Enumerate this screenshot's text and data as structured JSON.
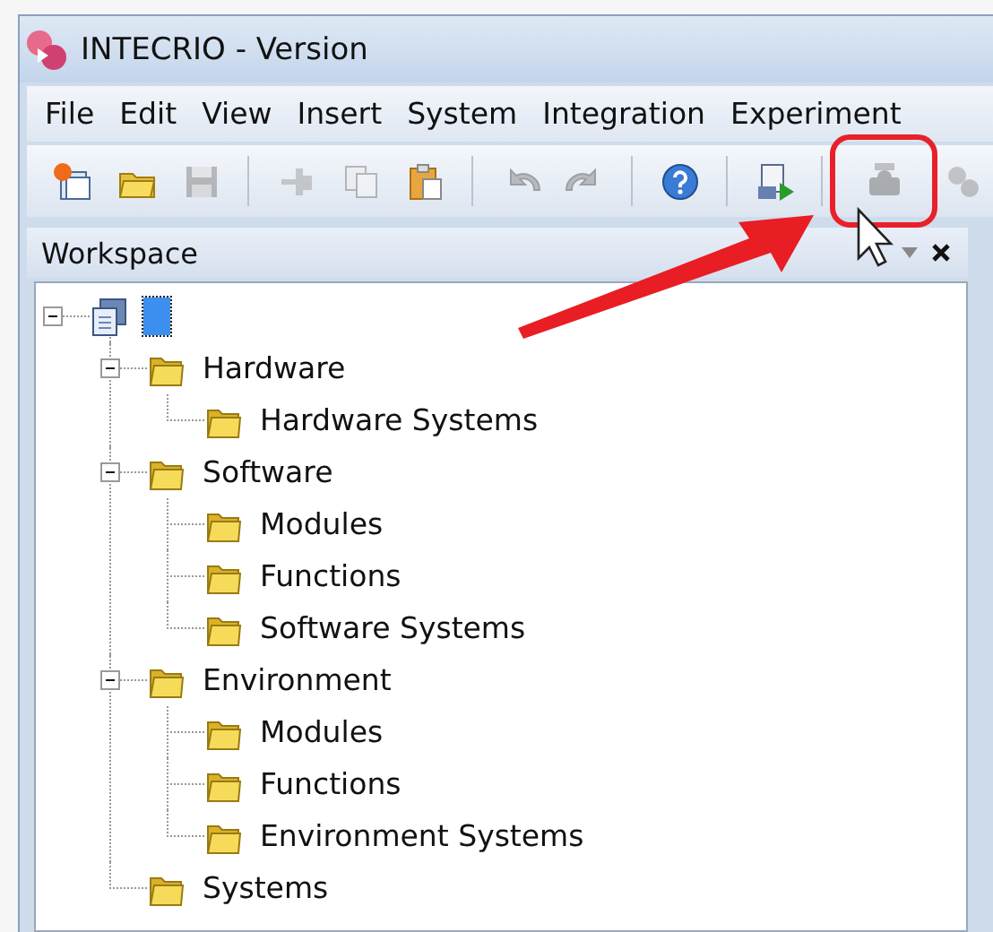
{
  "window": {
    "title": "INTECRIO - Version"
  },
  "menu": [
    "File",
    "Edit",
    "View",
    "Insert",
    "System",
    "Integration",
    "Experiment"
  ],
  "toolbar": [
    {
      "kind": "button",
      "disabled": false,
      "highlighted": false
    },
    {
      "kind": "button",
      "disabled": false,
      "highlighted": false
    },
    {
      "kind": "button",
      "disabled": true,
      "highlighted": false
    },
    {
      "kind": "separator"
    },
    {
      "kind": "button",
      "disabled": true,
      "highlighted": false
    },
    {
      "kind": "button",
      "disabled": true,
      "highlighted": false
    },
    {
      "kind": "button",
      "disabled": false,
      "highlighted": false
    },
    {
      "kind": "separator"
    },
    {
      "kind": "button",
      "disabled": true,
      "highlighted": false
    },
    {
      "kind": "button",
      "disabled": true,
      "highlighted": false
    },
    {
      "kind": "separator"
    },
    {
      "kind": "button",
      "disabled": false,
      "highlighted": false
    },
    {
      "kind": "separator"
    },
    {
      "kind": "button",
      "disabled": false,
      "highlighted": false
    },
    {
      "kind": "separator"
    },
    {
      "kind": "button",
      "disabled": true,
      "highlighted": true
    },
    {
      "kind": "button",
      "disabled": true,
      "highlighted": false
    }
  ],
  "panel": {
    "title": "Workspace"
  },
  "tree": [
    {
      "selected": true,
      "expanded": true,
      "children": [
        {
          "label": "Hardware",
          "selected": false,
          "expanded": true,
          "children": [
            {
              "label": "Hardware Systems",
              "selected": false
            }
          ]
        },
        {
          "label": "Software",
          "selected": false,
          "expanded": true,
          "children": [
            {
              "label": "Modules",
              "selected": false
            },
            {
              "label": "Functions",
              "selected": false
            },
            {
              "label": "Software Systems",
              "selected": false
            }
          ]
        },
        {
          "label": "Environment",
          "selected": false,
          "expanded": true,
          "children": [
            {
              "label": "Modules",
              "selected": false
            },
            {
              "label": "Functions",
              "selected": false
            },
            {
              "label": "Environment Systems",
              "selected": false
            }
          ]
        },
        {
          "label": "Systems",
          "selected": false
        }
      ]
    }
  ]
}
